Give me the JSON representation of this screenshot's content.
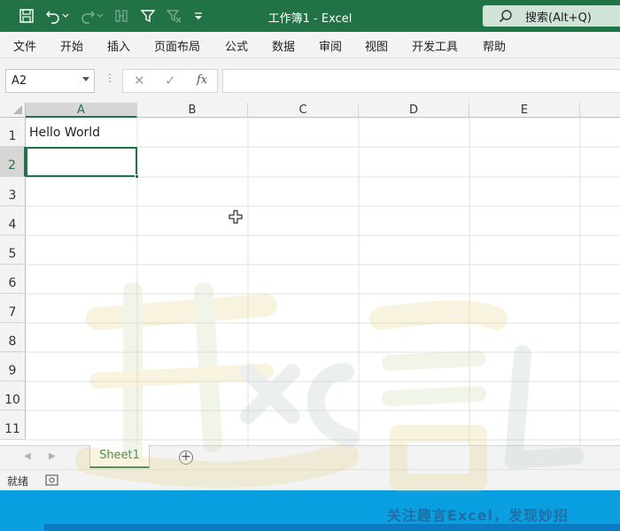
{
  "titlebar": {
    "title": "工作簿1  -  Excel",
    "search_label": "搜索(Alt+Q)",
    "bg_color": "#217346",
    "icons": [
      "save-icon",
      "undo-icon",
      "redo-icon",
      "touch-mode-icon",
      "filter-icon",
      "clear-filter-icon",
      "customize-qat-icon",
      "search-icon"
    ]
  },
  "menu": {
    "items": [
      "文件",
      "开始",
      "插入",
      "页面布局",
      "公式",
      "数据",
      "审阅",
      "视图",
      "开发工具",
      "帮助"
    ]
  },
  "formula_bar": {
    "name_box": "A2",
    "cancel_symbol": "✕",
    "enter_symbol": "✓",
    "fx_symbol": "fx",
    "formula": ""
  },
  "sheet": {
    "columns": [
      "A",
      "B",
      "C",
      "D",
      "E"
    ],
    "rows": [
      "1",
      "2",
      "3",
      "4",
      "5",
      "6",
      "7",
      "8",
      "9",
      "10",
      "11"
    ],
    "selected_column": "A",
    "selected_row": "2",
    "cells": {
      "A1": "Hello World"
    }
  },
  "tabs": {
    "sheet_name": "Sheet1",
    "add_symbol": "+"
  },
  "status": {
    "text": "就绪"
  },
  "banner": {
    "text": "关注趣言Excel，发现妙招"
  },
  "watermark": {
    "text": "趣言"
  },
  "colors": {
    "accent": "#217346",
    "banner": "#0a9fe0"
  }
}
